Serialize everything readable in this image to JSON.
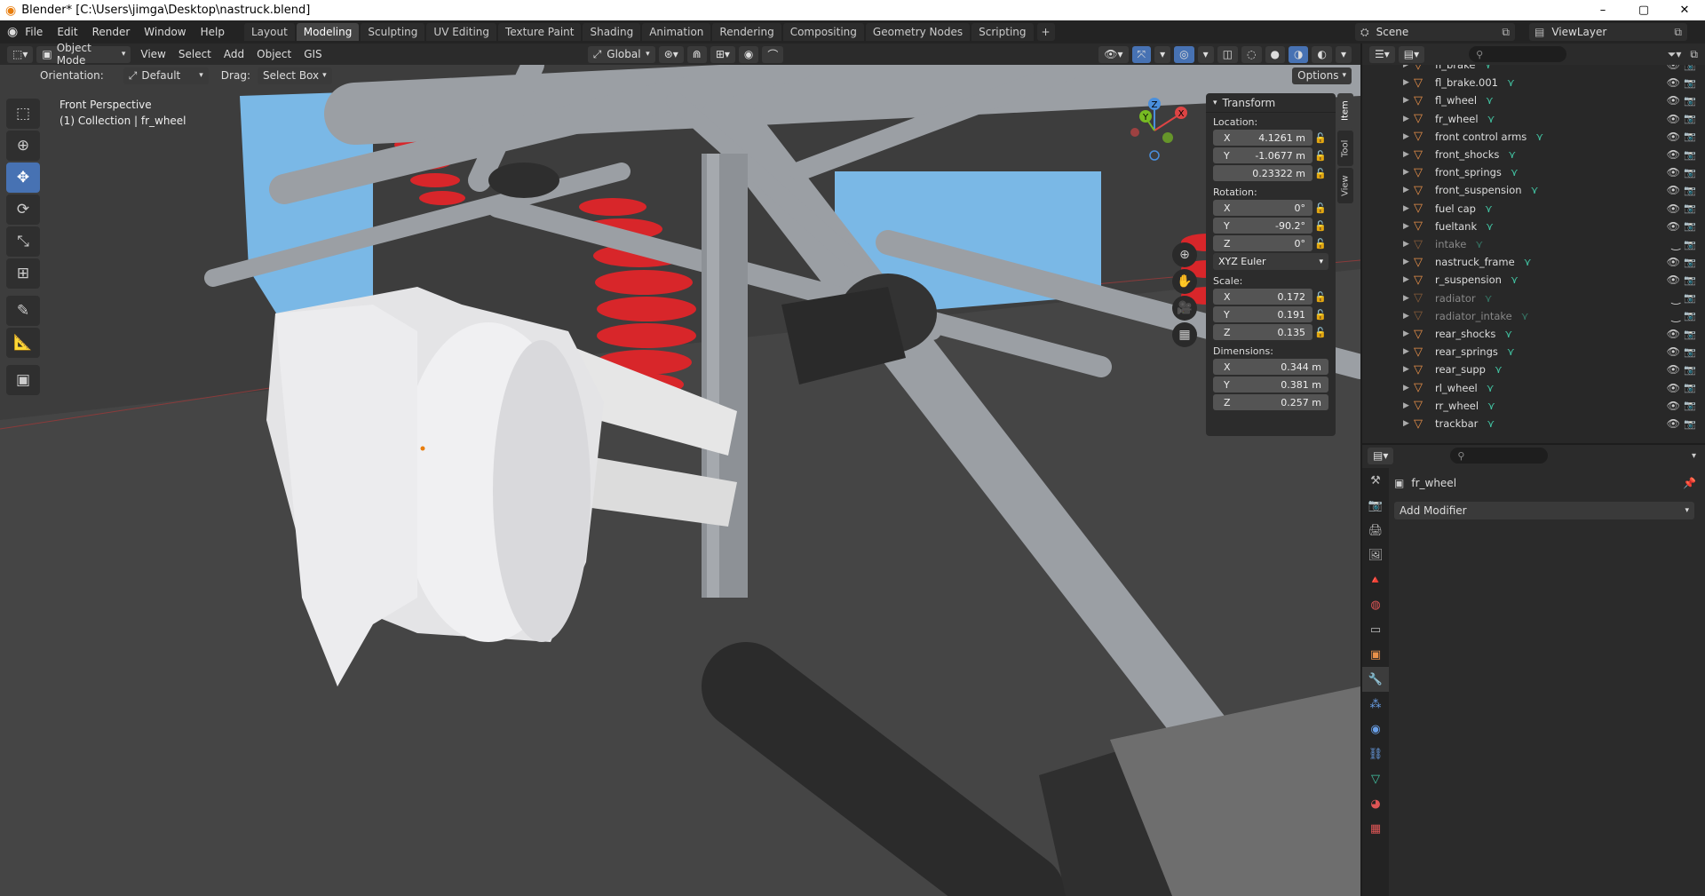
{
  "window": {
    "title": "Blender* [C:\\Users\\jimga\\Desktop\\nastruck.blend]",
    "minimize": "–",
    "maximize": "▢",
    "close": "✕"
  },
  "menu": {
    "file": "File",
    "edit": "Edit",
    "render": "Render",
    "window": "Window",
    "help": "Help"
  },
  "workspaces": [
    "Layout",
    "Modeling",
    "Sculpting",
    "UV Editing",
    "Texture Paint",
    "Shading",
    "Animation",
    "Rendering",
    "Compositing",
    "Geometry Nodes",
    "Scripting"
  ],
  "active_workspace": "Modeling",
  "scene": {
    "name": "Scene",
    "view_layer": "ViewLayer"
  },
  "viewport_header": {
    "mode": "Object Mode",
    "view": "View",
    "select": "Select",
    "add": "Add",
    "object": "Object",
    "gis": "GIS",
    "transform_space": "Global"
  },
  "tool_options": {
    "orientation_label": "Orientation:",
    "orientation_value": "Default",
    "drag_label": "Drag:",
    "drag_value": "Select Box",
    "options": "Options"
  },
  "viewport_info": {
    "view_name": "Front Perspective",
    "collection": "(1) Collection | fr_wheel"
  },
  "transform_panel": {
    "title": "Transform",
    "location_label": "Location:",
    "location": [
      {
        "axis": "X",
        "value": "4.1261 m"
      },
      {
        "axis": "Y",
        "value": "-1.0677 m"
      },
      {
        "axis": "",
        "value": "0.23322 m"
      }
    ],
    "rotation_label": "Rotation:",
    "rotation": [
      {
        "axis": "X",
        "value": "0°"
      },
      {
        "axis": "Y",
        "value": "-90.2°"
      },
      {
        "axis": "Z",
        "value": "0°"
      }
    ],
    "rotation_mode": "XYZ Euler",
    "scale_label": "Scale:",
    "scale": [
      {
        "axis": "X",
        "value": "0.172"
      },
      {
        "axis": "Y",
        "value": "0.191"
      },
      {
        "axis": "Z",
        "value": "0.135"
      }
    ],
    "dimensions_label": "Dimensions:",
    "dimensions": [
      {
        "axis": "X",
        "value": "0.344 m"
      },
      {
        "axis": "Y",
        "value": "0.381 m"
      },
      {
        "axis": "Z",
        "value": "0.257 m"
      }
    ]
  },
  "sidebar_tabs": [
    "Item",
    "Tool",
    "View"
  ],
  "gizmo": {
    "x": "X",
    "y": "Y",
    "z": "Z"
  },
  "outliner": {
    "items": [
      {
        "name": "fl_brake",
        "dim": false
      },
      {
        "name": "fl_brake.001",
        "dim": false
      },
      {
        "name": "fl_wheel",
        "dim": false
      },
      {
        "name": "fr_wheel",
        "dim": false
      },
      {
        "name": "front control arms",
        "dim": false
      },
      {
        "name": "front_shocks",
        "dim": false
      },
      {
        "name": "front_springs",
        "dim": false
      },
      {
        "name": "front_suspension",
        "dim": false
      },
      {
        "name": "fuel cap",
        "dim": false
      },
      {
        "name": "fueltank",
        "dim": false
      },
      {
        "name": "intake",
        "dim": true
      },
      {
        "name": "nastruck_frame",
        "dim": false
      },
      {
        "name": "r_suspension",
        "dim": false
      },
      {
        "name": "radiator",
        "dim": true
      },
      {
        "name": "radiator_intake",
        "dim": true
      },
      {
        "name": "rear_shocks",
        "dim": false
      },
      {
        "name": "rear_springs",
        "dim": false
      },
      {
        "name": "rear_supp",
        "dim": false
      },
      {
        "name": "rl_wheel",
        "dim": false
      },
      {
        "name": "rr_wheel",
        "dim": false
      },
      {
        "name": "trackbar",
        "dim": false
      }
    ]
  },
  "properties": {
    "object_name": "fr_wheel",
    "add_modifier": "Add Modifier"
  },
  "colors": {
    "accent": "#4772b3",
    "object_icon": "#e9914a",
    "mesh_icon": "#42c4a3",
    "red_spring": "#d8262a",
    "blue_panel": "#7ab8e6"
  }
}
